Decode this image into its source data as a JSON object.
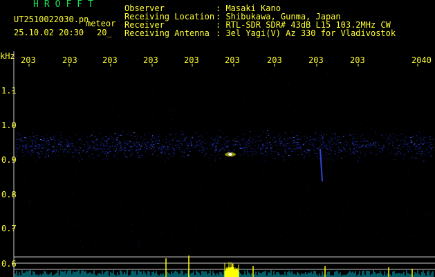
{
  "header": {
    "brand": "HROFFT",
    "filename": "UT2510022030.pn",
    "tag": "meteor",
    "datetime": "25.10.02 20:30",
    "datetime_tail": "20_",
    "fields": [
      {
        "label": "Observer",
        "value": ": Masaki Kano"
      },
      {
        "label": "Receiving Location",
        "value": ": Shibukawa, Gunma, Japan"
      },
      {
        "label": "Receiver",
        "value": ": RTL-SDR SDR# 43dB L15 103.2MHz CW"
      },
      {
        "label": "Receiving Antenna",
        "value": ": 3el Yagi(V) Az 330 for Vladivostok"
      }
    ]
  },
  "axis": {
    "y_unit": "kHz",
    "y_ticks": [
      "1.1",
      "1.0",
      "0.9",
      "0.8",
      "0.7",
      "0.6"
    ],
    "x_ticks": [
      "203",
      "203",
      "203",
      "203",
      "203",
      "203",
      "203",
      "203",
      "203",
      "2040"
    ]
  },
  "colors": {
    "text": "#ffff33",
    "brand": "#19e35a",
    "grid": "#c8c8c8",
    "signal": "#2233ff",
    "meteor": "#ffff00",
    "noise": "#00e5ff"
  }
}
